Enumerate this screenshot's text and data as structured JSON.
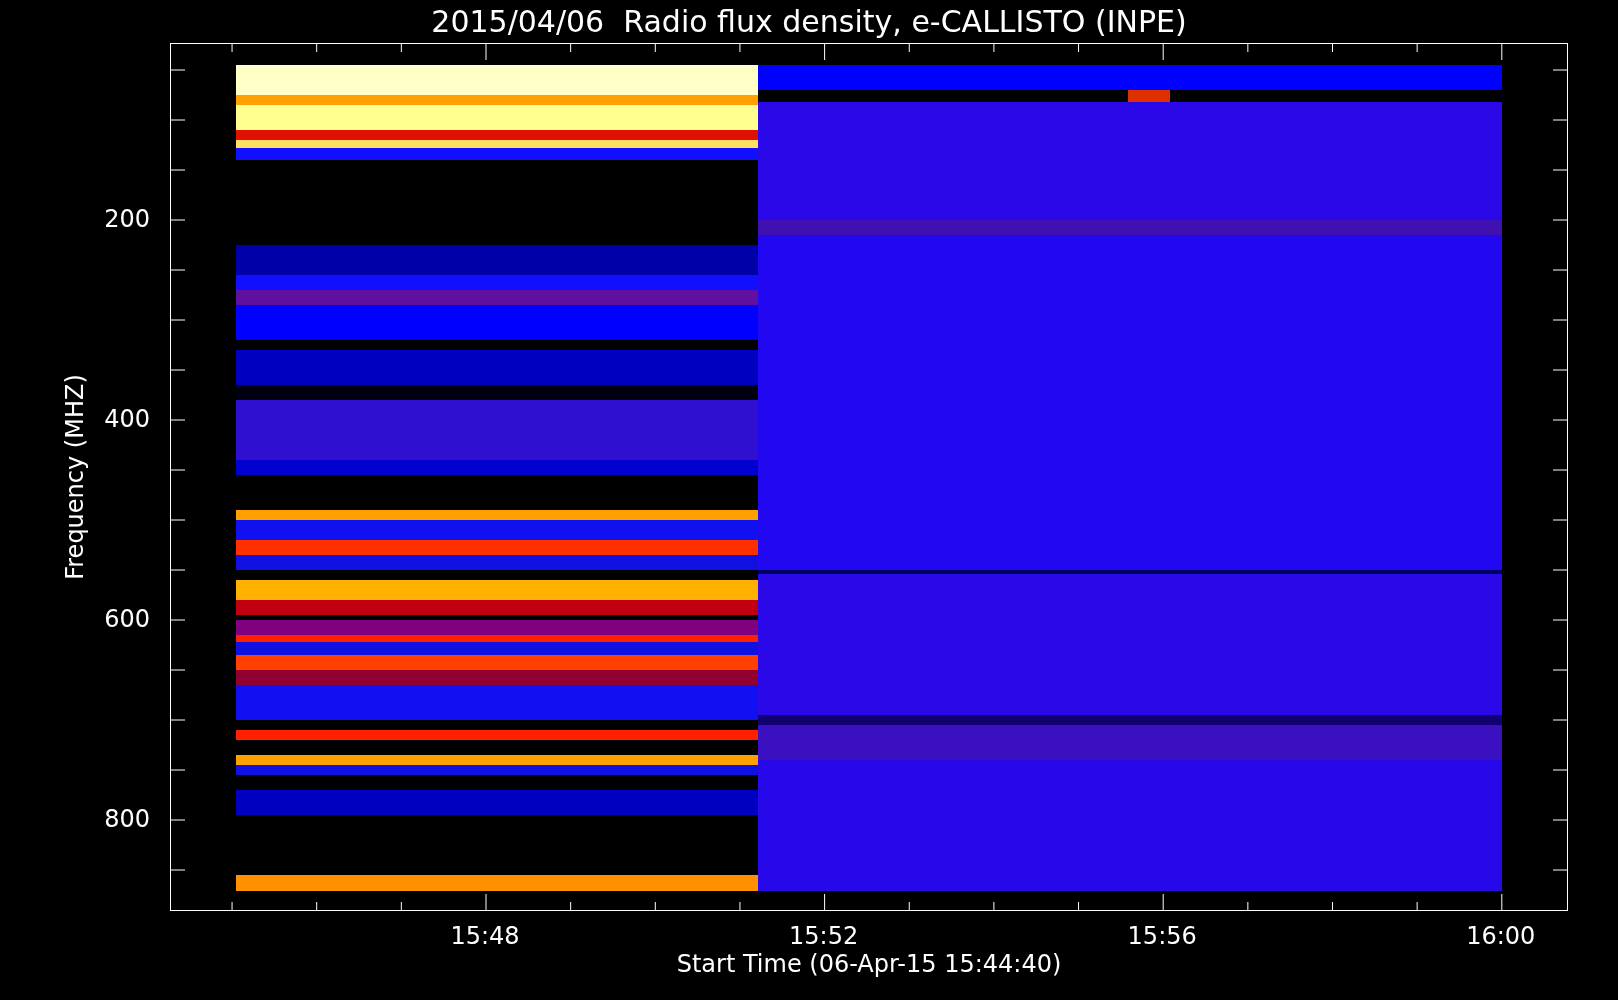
{
  "title": "2015/04/06  Radio flux density, e-CALLISTO (INPE)",
  "y_axis": {
    "label": "Frequency (MHZ)",
    "ticks": [
      "200",
      "400",
      "600",
      "800"
    ]
  },
  "x_axis": {
    "label": "Start Time (06-Apr-15 15:44:40)",
    "ticks": [
      "15:48",
      "15:52",
      "15:56",
      "16:00"
    ]
  }
}
